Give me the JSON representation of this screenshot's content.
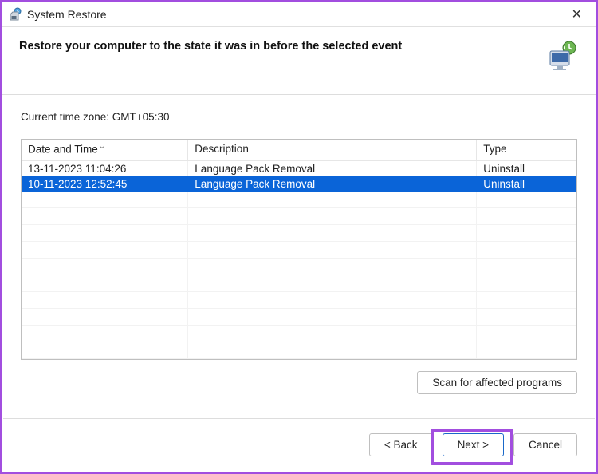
{
  "window": {
    "title": "System Restore"
  },
  "header": {
    "heading": "Restore your computer to the state it was in before the selected event"
  },
  "timezone_label": "Current time zone: GMT+05:30",
  "table": {
    "headers": {
      "date": "Date and Time",
      "description": "Description",
      "type": "Type"
    },
    "rows": [
      {
        "date": "13-11-2023 11:04:26",
        "description": "Language Pack Removal",
        "type": "Uninstall",
        "selected": false
      },
      {
        "date": "10-11-2023 12:52:45",
        "description": "Language Pack Removal",
        "type": "Uninstall",
        "selected": true
      }
    ]
  },
  "buttons": {
    "scan": "Scan for affected programs",
    "back": "< Back",
    "next": "Next >",
    "cancel": "Cancel"
  }
}
